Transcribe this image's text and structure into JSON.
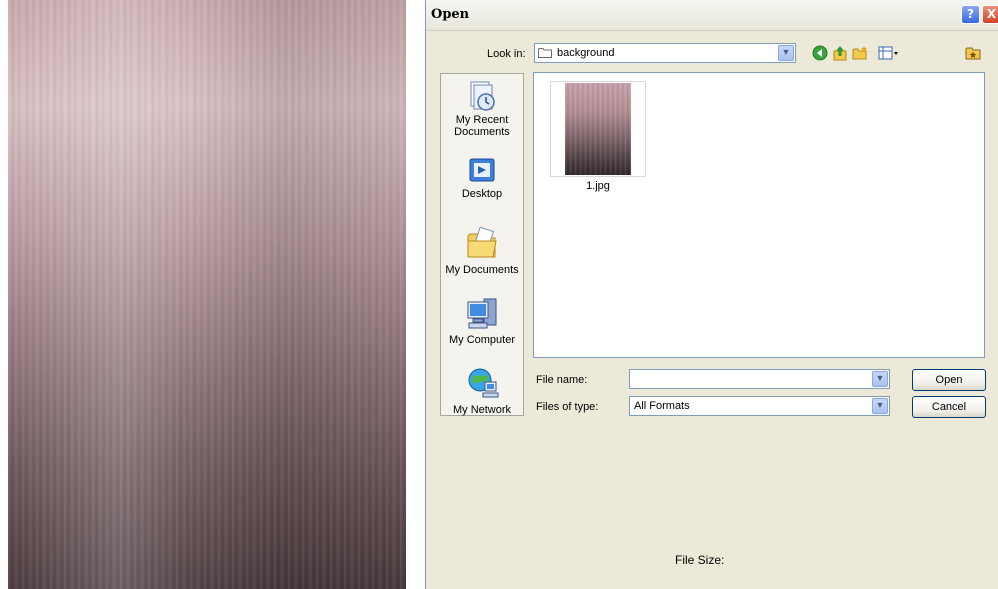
{
  "dialog": {
    "title": "Open",
    "help_label": "?",
    "close_label": "X"
  },
  "lookin": {
    "label": "Look in:",
    "value": "background"
  },
  "toolbar": {
    "icons": [
      "back-icon",
      "up-folder-icon",
      "new-folder-icon",
      "views-menu-icon"
    ],
    "extra_icon": "favorites-icon"
  },
  "places": [
    {
      "label": "My Recent Documents",
      "icon": "recent-documents-icon"
    },
    {
      "label": "Desktop",
      "icon": "desktop-icon"
    },
    {
      "label": "My Documents",
      "icon": "my-documents-icon"
    },
    {
      "label": "My Computer",
      "icon": "my-computer-icon"
    },
    {
      "label": "My Network",
      "icon": "my-network-icon"
    }
  ],
  "files": [
    {
      "name": "1.jpg"
    }
  ],
  "filename": {
    "label": "File name:",
    "value": ""
  },
  "filetype": {
    "label": "Files of type:",
    "value": "All Formats"
  },
  "buttons": {
    "open": "Open",
    "cancel": "Cancel"
  },
  "file_size_label": "File Size:"
}
